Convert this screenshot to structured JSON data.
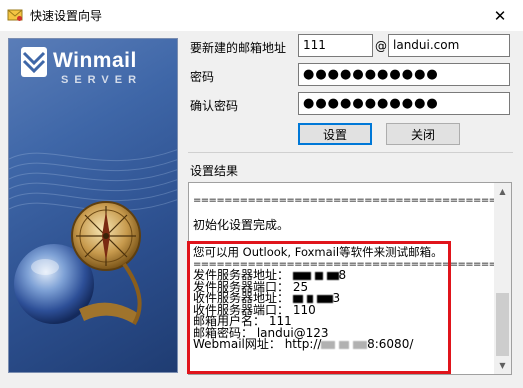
{
  "window": {
    "title": "快速设置向导",
    "close_glyph": "✕"
  },
  "banner": {
    "logo_word": "Winmail",
    "logo_sub": "SERVER"
  },
  "form": {
    "email_label": "要新建的邮箱地址",
    "email_user": "111",
    "at_sign": "@",
    "email_domain": "landui.com",
    "password_label": "密码",
    "password_value": "●●●●●●●●●●●",
    "confirm_label": "确认密码",
    "confirm_value": "●●●●●●●●●●●",
    "setup_button": "设置",
    "close_button": "关闭"
  },
  "results": {
    "label": "设置结果",
    "lines": [
      "",
      "==========================================",
      "",
      "初始化设置完成。",
      "",
      "您可以用 Outlook, Foxmail等软件来测试邮箱。",
      "==========================================",
      "发件服务器地址：",
      "发件服务器端口：  25",
      "收件服务器地址：",
      "收件服务器端口：  110",
      "邮箱用户名：  111",
      "邮箱密码：  landui@123",
      "Webmail网址：  http://"
    ],
    "smtp_suffix": "8",
    "pop_suffix": "3",
    "webmail_suffix": "8:6080/"
  },
  "colors": {
    "highlight_border": "#e0141b",
    "banner_blue": "#3f67a8",
    "focus_blue": "#0078d7"
  }
}
